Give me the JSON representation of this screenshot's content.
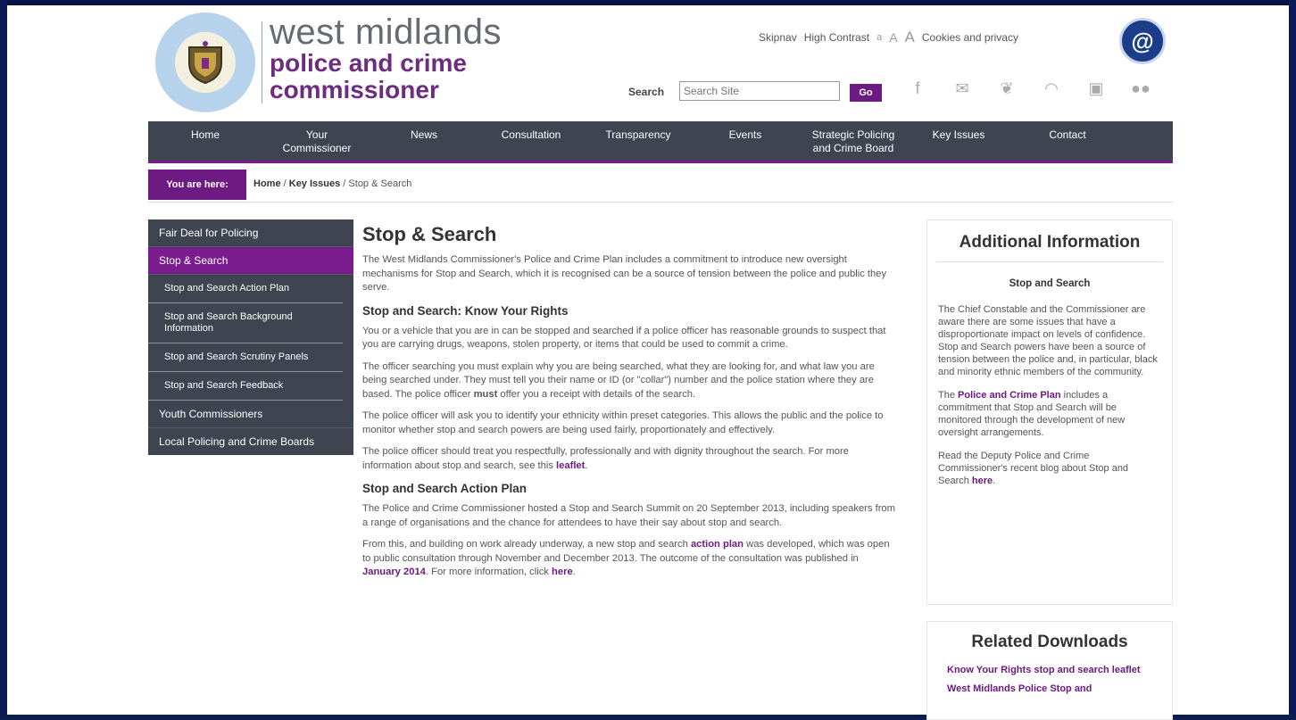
{
  "brand": {
    "line1": "west midlands",
    "line2": "police and crime",
    "line3": "commissioner"
  },
  "toplinks": {
    "skipnav": "Skipnav",
    "high_contrast": "High Contrast",
    "text_size_small": "a",
    "text_size_medium": "A",
    "text_size_large": "A",
    "cookies": "Cookies and privacy"
  },
  "search": {
    "label": "Search",
    "placeholder": "Search Site",
    "go_label": "Go"
  },
  "social_icons": [
    "facebook-icon",
    "email-icon",
    "twitter-icon",
    "rss-icon",
    "youtube-icon",
    "flickr-icon"
  ],
  "nav": [
    {
      "label": "Home"
    },
    {
      "label": "Your Commissioner"
    },
    {
      "label": "News"
    },
    {
      "label": "Consultation"
    },
    {
      "label": "Transparency"
    },
    {
      "label": "Events"
    },
    {
      "label": "Strategic Policing and Crime Board"
    },
    {
      "label": "Key Issues"
    },
    {
      "label": "Contact"
    }
  ],
  "breadcrumb": {
    "label": "You are here:",
    "home": "Home",
    "sep": "/",
    "key_issues": "Key Issues",
    "current": "Stop & Search"
  },
  "sidebar": {
    "items": [
      {
        "label": "Fair Deal for Policing"
      },
      {
        "label": "Stop & Search"
      },
      {
        "label": "Stop and Search Action Plan"
      },
      {
        "label": "Stop and Search Background Information"
      },
      {
        "label": "Stop and Search Scrutiny Panels"
      },
      {
        "label": "Stop and Search Feedback"
      },
      {
        "label": "Youth Commissioners"
      },
      {
        "label": "Local Policing and Crime Boards"
      }
    ]
  },
  "main": {
    "title": "Stop & Search",
    "intro": "The West Midlands Commissioner's Police and Crime Plan includes a commitment to introduce new oversight mechanisms for Stop and Search, which it is recognised can be a source of tension between the police and public they serve.",
    "h_rights": "Stop and Search: Know Your Rights",
    "p_rights1": "You or a vehicle that you are in can be stopped and searched if a police officer has reasonable grounds to suspect that you are carrying drugs, weapons, stolen property, or items that could be used to commit a crime.",
    "p_rights2a": "The officer searching you must explain why you are being searched, what they are looking for, and what law you are being searched under.  They must tell you their name or ID (or \"collar\") number and the police station where they are based.  The police officer ",
    "p_rights2_bold": "must",
    "p_rights2b": " offer you a receipt with details of the search.",
    "p_rights3": "The police officer will ask you to identify your ethnicity within preset categories.  This allows the public and the police to monitor whether stop and search powers are being used fairly, proportionately and effectively.",
    "p_rights4a": "The police officer should treat you respectfully, professionally and with dignity throughout the search.  For more information about stop and search, see this ",
    "p_rights4_link": "leaflet",
    "p_rights4b": ".",
    "h_action": "Stop and Search Action Plan",
    "p_action1": "The Police and Crime Commissioner hosted a Stop and Search Summit on 20 September 2013, including speakers from a range of organisations and the chance for attendees to have their say about stop and search.",
    "p_action2a": "From this, and building on work already underway, a new stop and search ",
    "p_action2_link": "action plan",
    "p_action2b": " was developed, which was open to public consultation through November and December 2013.  The outcome of the consultation was published in ",
    "p_action2_link2": "January 2014",
    "p_action2c": ".  For more information, click ",
    "p_action2_link3": "here",
    "p_action2d": "."
  },
  "additional": {
    "title": "Additional Information",
    "subtitle": "Stop and Search",
    "p1": "The Chief Constable and the Commissioner are aware there are some issues that have a disproportionate impact on levels of confidence.  Stop and Search powers have been a source of tension between the police and, in particular, black and minority ethnic members of the community.",
    "p2_pre": "The ",
    "p2_link": "Police and Crime Plan",
    "p2_post": " includes a commitment that Stop and Search will be monitored through the development of new oversight arrangements.",
    "p3_pre": "Read the Deputy Police and Crime Commissioner's recent blog about Stop and Search ",
    "p3_link": "here",
    "p3_post": "."
  },
  "downloads": {
    "title": "Related Downloads",
    "links": [
      {
        "label": "Know Your Rights stop and search leaflet"
      },
      {
        "label": "West Midlands Police Stop and"
      }
    ]
  },
  "colors": {
    "purple": "#6d1a83",
    "nav_bg": "#3e4551",
    "accent_border": "#7a1c8e"
  }
}
